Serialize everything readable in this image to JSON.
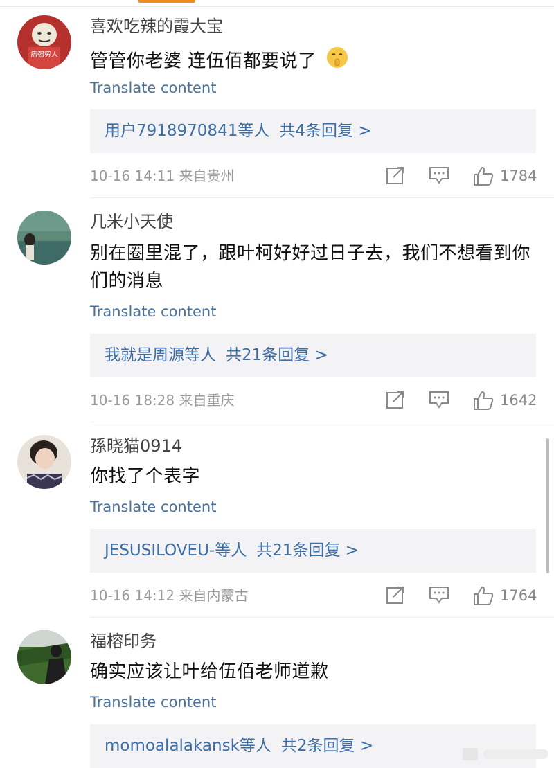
{
  "comments": [
    {
      "username": "喜欢吃辣的霞大宝",
      "content": "管管你老婆 连伍佰都要说了",
      "emoji": "shushing-face-emoji",
      "translate": "Translate content",
      "reply": {
        "who": "用户7918970841",
        "suffix": "等人",
        "count": "共4条回复 >"
      },
      "meta": "10-16 14:11 来自贵州",
      "likes": "1784",
      "avatar_text": "痞强穷人"
    },
    {
      "username": "几米小天使",
      "content": "别在圈里混了，跟叶柯好好过日子去，我们不想看到你们的消息",
      "translate": "Translate content",
      "reply": {
        "who": "我就是周源",
        "suffix": "等人",
        "count": "共21条回复 >"
      },
      "meta": "10-16 18:28 来自重庆",
      "likes": "1642"
    },
    {
      "username": "孫晓猫0914",
      "content": "你找了个表字",
      "translate": "Translate content",
      "reply": {
        "who": "JESUSILOVEU-",
        "suffix": "等人",
        "count": "共21条回复 >"
      },
      "meta": "10-16 14:12 来自内蒙古",
      "likes": "1764"
    },
    {
      "username": "福榕印务",
      "content": "确实应该让叶给伍佰老师道歉",
      "translate": "Translate content",
      "reply": {
        "who": "momoalalakansk",
        "suffix": "等人",
        "count": "共2条回复 >"
      }
    }
  ],
  "icons": [
    "share-icon",
    "comment-icon",
    "like-icon"
  ],
  "colors": {
    "link": "#3d6ea6",
    "translate": "#4b7299",
    "reply_bg": "#f3f3f5",
    "accent": "#f28c1f",
    "meta": "#999999"
  }
}
